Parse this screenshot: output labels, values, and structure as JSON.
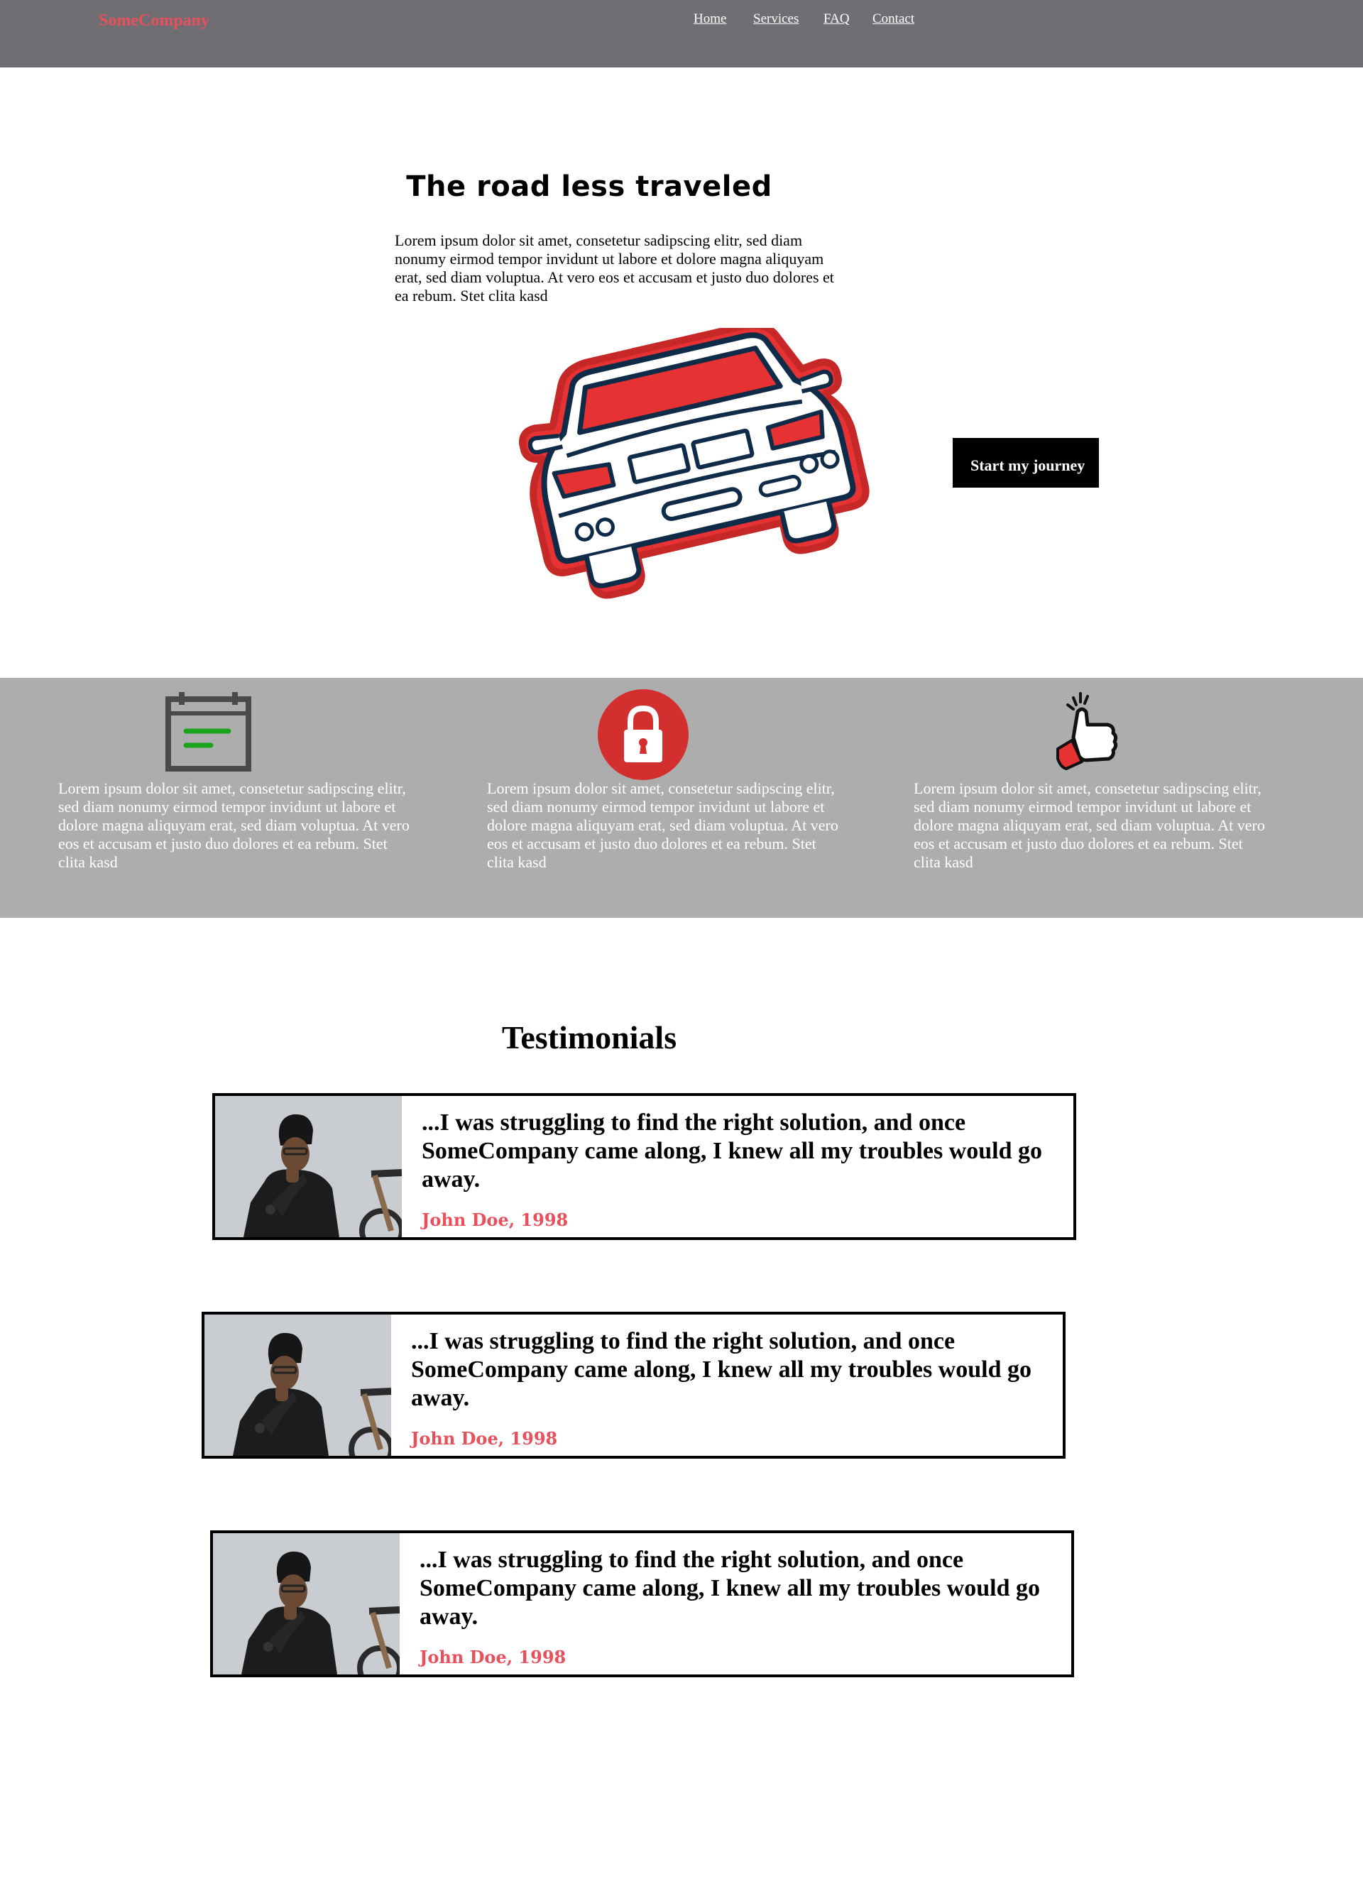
{
  "header": {
    "brand": "SomeCompany",
    "nav": [
      "Home",
      "Services",
      "FAQ",
      "Contact"
    ]
  },
  "hero": {
    "title": "The road less traveled",
    "text": "Lorem ipsum dolor sit amet, consetetur sadipscing elitr, sed diam nonumy eirmod tempor invidunt ut labore et dolore magna aliquyam erat, sed diam voluptua. At vero eos et accusam et justo duo dolores et ea rebum. Stet clita kasd",
    "cta": "Start my journey"
  },
  "features": [
    {
      "icon": "calendar-icon",
      "text": "Lorem ipsum dolor sit amet, consetetur sadipscing elitr, sed diam nonumy eirmod tempor invidunt ut labore et dolore magna aliquyam erat, sed diam voluptua. At vero eos et accusam et justo duo dolores et ea rebum. Stet clita kasd"
    },
    {
      "icon": "lock-icon",
      "text": "Lorem ipsum dolor sit amet, consetetur sadipscing elitr, sed diam nonumy eirmod tempor invidunt ut labore et dolore magna aliquyam erat, sed diam voluptua. At vero eos et accusam et justo duo dolores et ea rebum. Stet clita kasd"
    },
    {
      "icon": "thumbs-up-icon",
      "text": "Lorem ipsum dolor sit amet, consetetur sadipscing elitr, sed diam nonumy eirmod tempor invidunt ut labore et dolore magna aliquyam erat, sed diam voluptua. At vero eos et accusam et justo duo dolores et ea rebum. Stet clita kasd"
    }
  ],
  "testimonials": {
    "title": "Testimonials",
    "items": [
      {
        "quote": "...I was struggling to find the right solution, and once SomeCompany came along, I knew all my troubles would go away.",
        "author": "John Doe, 1998"
      },
      {
        "quote": "...I was struggling to find the right solution, and once SomeCompany came along, I knew all my troubles would go away.",
        "author": "John Doe, 1998"
      },
      {
        "quote": "...I was struggling to find the right solution, and once SomeCompany came along, I knew all my troubles would go away.",
        "author": "John Doe, 1998"
      }
    ]
  },
  "colors": {
    "header_bg": "#6e6e73",
    "brand": "#e8505b",
    "features_bg": "#adadad",
    "accent_red": "#e63232",
    "outline_navy": "#0f2b47",
    "author": "#e8505b"
  }
}
